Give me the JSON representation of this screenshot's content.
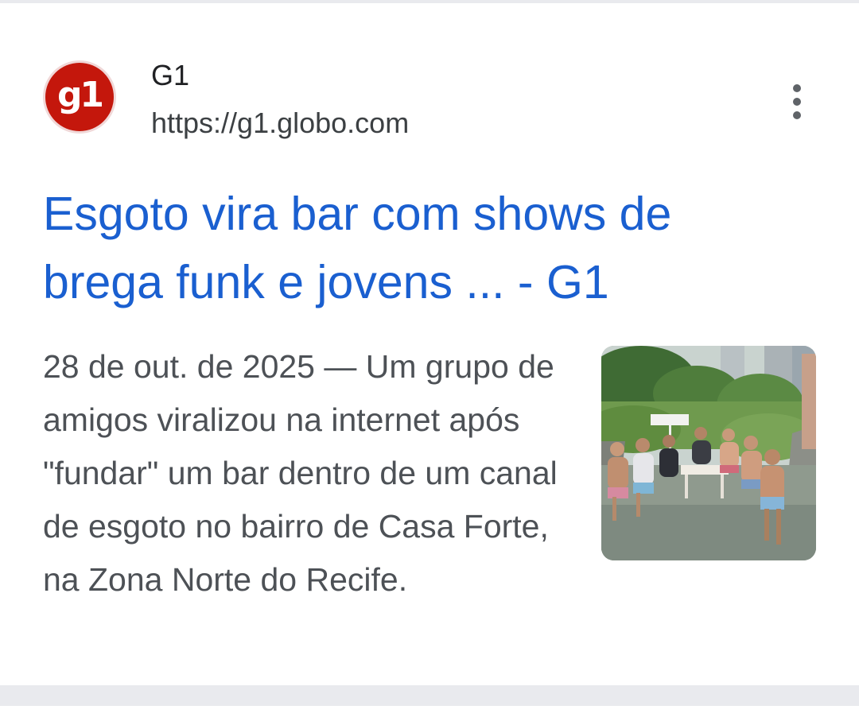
{
  "result": {
    "site_name": "G1",
    "favicon_text": "g1",
    "url": "https://g1.globo.com",
    "title_line1": "Esgoto vira bar com shows de",
    "title_line2": "brega funk e jovens ... - G1",
    "date": "28 de out. de 2025",
    "separator": " — ",
    "snippet": "Um grupo de amigos viralizou na internet após \"fundar\" um bar dentro de um canal de esgoto no bairro de Casa Forte, na Zona Norte do Recife.",
    "thumbnail": "photo of young men sitting around a table in a sewage canal"
  },
  "colors": {
    "title_link": "#1a5fd0",
    "favicon_bg": "#c4170c",
    "snippet_text": "#4d5156",
    "divider": "#e9eaee"
  },
  "icons": {
    "favicon": "g1-logo-icon",
    "menu": "more-vert-icon"
  }
}
